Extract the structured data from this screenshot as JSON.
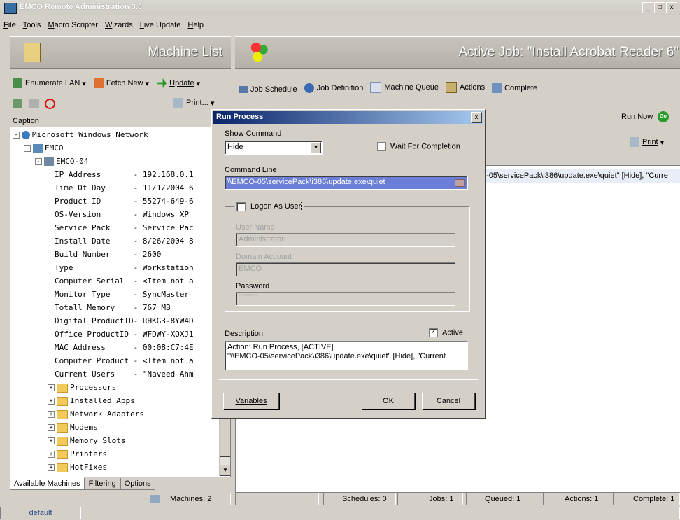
{
  "window": {
    "title": "EMCO Remote Administration 3.0",
    "min": "_",
    "max": "□",
    "close": "x"
  },
  "menu": [
    "File",
    "Tools",
    "Macro Scripter",
    "Wizards",
    "Live Update",
    "Help"
  ],
  "left": {
    "header": "Machine List",
    "toolbar": {
      "enumerate": "Enumerate LAN",
      "fetch": "Fetch New",
      "update": "Update",
      "print": "Print..."
    },
    "column": "Caption",
    "tree": {
      "root": "Microsoft Windows Network",
      "domain": "EMCO",
      "machine": "EMCO-04",
      "props": [
        "IP Address       - 192.168.0.1",
        "Time Of Day      - 11/1/2004 6",
        "Product ID       - 55274-649-6",
        "OS-Version       - Windows XP ",
        "Service Pack     - Service Pac",
        "Install Date     - 8/26/2004 8",
        "Build Number     - 2600",
        "Type             - Workstation",
        "Computer Serial  - <Item not a",
        "Monitor Type     - SyncMaster ",
        "Totall Memory    - 767 MB",
        "Digital ProductID- RHKG3-8YW4D",
        "Office ProductID - WFDWY-XQXJ1",
        "MAC Address      - 00:08:C7:4E",
        "Computer Product - <Item not a",
        "Current Users    - \"Naveed Ahm"
      ],
      "folders": [
        "Processors",
        "Installed Apps",
        "Network Adapters",
        "Modems",
        "Memory Slots",
        "Printers",
        "HotFixes"
      ]
    },
    "tabs": [
      "Available Machines",
      "Filtering",
      "Options"
    ],
    "status": "Machines: 2"
  },
  "right": {
    "header": "Active Job: \"Install Acrobat Reader 6\"",
    "tabs": [
      "Job Schedule",
      "Job Definition",
      "Machine Queue",
      "Actions",
      "Complete"
    ],
    "run_now": "Run Now",
    "go": "Go",
    "print": "Print",
    "row_text": "0-05\\servicePack\\i386\\update.exe\\quiet\" [Hide], \"Curre",
    "status": {
      "schedules": "Schedules: 0",
      "jobs": "Jobs: 1",
      "queued": "Queued: 1",
      "actions": "Actions: 1",
      "complete": "Complete: 1"
    }
  },
  "dialog": {
    "title": "Run Process",
    "close": "x",
    "show_command_label": "Show Command",
    "show_command_value": "Hide",
    "wait_label": "Wait For Completion",
    "command_line_label": "Command Line",
    "command_line_value": "\\\\EMCO-05\\servicePack\\i386\\update.exe\\quiet",
    "logon_label": "Logon As User",
    "user_name_label": "User Name",
    "user_name_value": "Administrator",
    "domain_label": "Domain Account",
    "domain_value": "EMCO",
    "password_label": "Password",
    "password_value": "**********",
    "description_label": "Description",
    "active_label": "Active",
    "description_line1": "Action: Run Process, [ACTIVE]",
    "description_line2": "\"\\\\EMCO-05\\servicePack\\i386\\update.exe\\quiet\" [Hide], \"Current",
    "variables": "Variables",
    "ok": "OK",
    "cancel": "Cancel"
  },
  "statusbar": {
    "default": "default"
  }
}
